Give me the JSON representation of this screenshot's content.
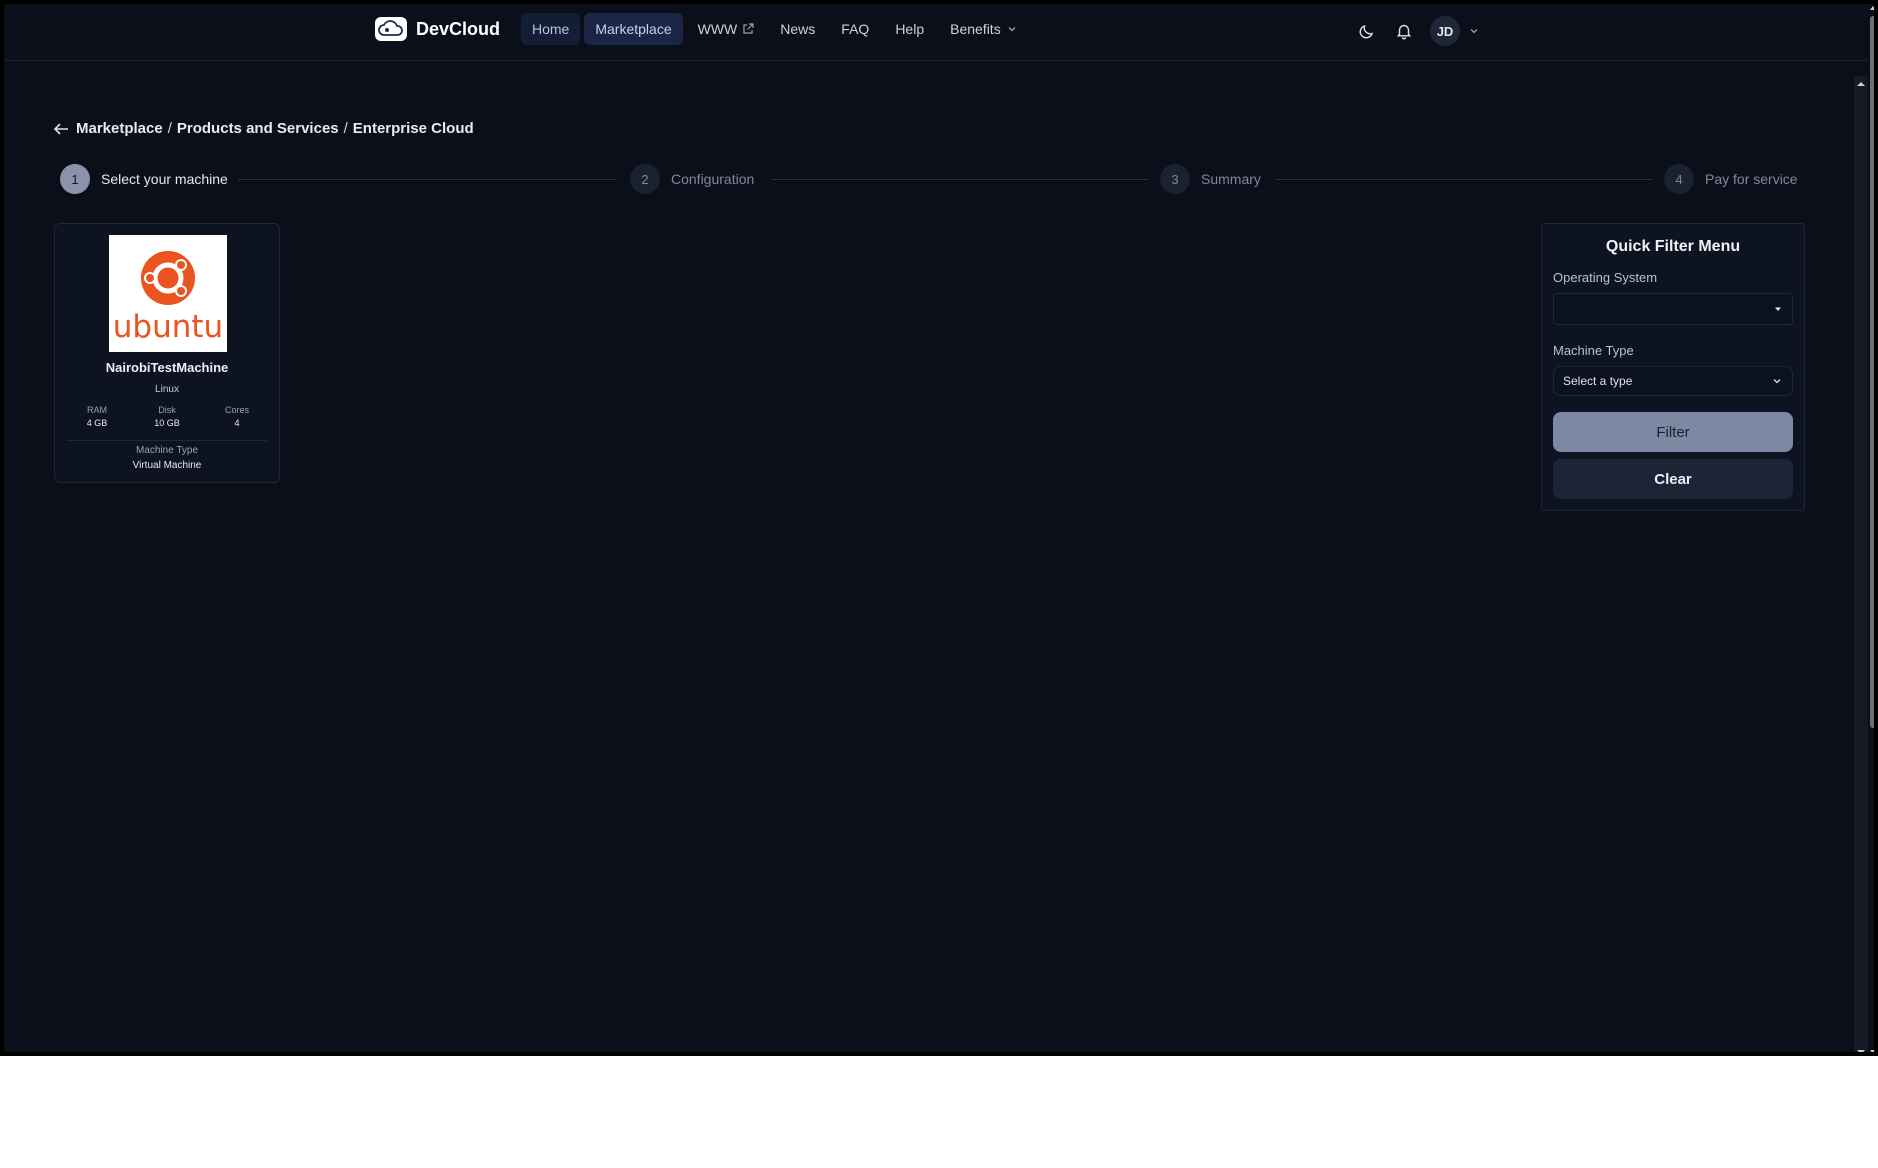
{
  "header": {
    "app_name": "DevCloud",
    "nav": [
      {
        "label": "Home"
      },
      {
        "label": "Marketplace"
      },
      {
        "label": "WWW"
      },
      {
        "label": "News"
      },
      {
        "label": "FAQ"
      },
      {
        "label": "Help"
      },
      {
        "label": "Benefits"
      }
    ],
    "user_initials": "JD"
  },
  "breadcrumb": {
    "items": [
      "Marketplace",
      "Products and Services",
      "Enterprise Cloud"
    ],
    "separator": "/"
  },
  "stepper": {
    "current_step": 1,
    "steps": [
      {
        "number": "1",
        "label": "Select your machine"
      },
      {
        "number": "2",
        "label": "Configuration"
      },
      {
        "number": "3",
        "label": "Summary"
      },
      {
        "number": "4",
        "label": "Pay for service"
      }
    ]
  },
  "machine_card": {
    "logo_text": "ubuntu",
    "name": "NairobiTestMachine",
    "os": "Linux",
    "specs": [
      {
        "label": "RAM",
        "value": "4 GB"
      },
      {
        "label": "Disk",
        "value": "10 GB"
      },
      {
        "label": "Cores",
        "value": "4"
      }
    ],
    "machine_type_label": "Machine Type",
    "machine_type_value": "Virtual Machine"
  },
  "filter_menu": {
    "title": "Quick Filter Menu",
    "os_label": "Operating System",
    "os_value": "",
    "type_label": "Machine Type",
    "type_value": "Select a type",
    "filter_button": "Filter",
    "clear_button": "Clear"
  },
  "colors": {
    "background": "#0a0f1a",
    "panel": "#0d1320",
    "nav_active": "#1b2647",
    "filter_button": "#7f88a3",
    "ubuntu_orange": "#e95420"
  }
}
